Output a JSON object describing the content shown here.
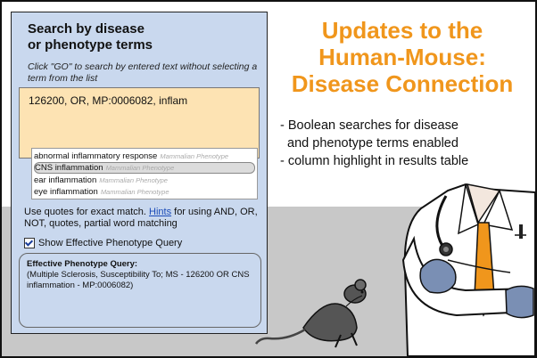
{
  "search_panel": {
    "title_line1": "Search by disease",
    "title_line2": "or phenotype terms",
    "instructions": "Click \"GO\" to search by entered text without selecting a term from the list",
    "query_value": "126200, OR, MP:0006082, inflam",
    "dropdown": [
      {
        "term": "abnormal inflammatory response",
        "category": "Mammalian Phenotype",
        "selected": false
      },
      {
        "term": "CNS inflammation",
        "category": "Mammalian Phenotype",
        "selected": true
      },
      {
        "term": "ear inflammation",
        "category": "Mammalian Phenotype",
        "selected": false
      },
      {
        "term": "eye inflammation",
        "category": "Mammalian Phenotype",
        "selected": false
      }
    ],
    "quotes_text_before": "Use quotes for exact match. ",
    "hints_link": "Hints",
    "quotes_text_after": " for using AND, OR, NOT, quotes, partial word matching",
    "show_effective_label": "Show Effective Phenotype Query",
    "effective_title": "Effective Phenotype Query:",
    "effective_body": "(Multiple Sclerosis, Susceptibility To; MS - 126200 OR CNS inflammation - MP:0006082)"
  },
  "headline": {
    "line1": "Updates to the",
    "line2": "Human-Mouse:",
    "line3": "Disease Connection"
  },
  "bullets": [
    "- Boolean searches for disease",
    "  and phenotype terms enabled",
    "- column highlight in results table"
  ],
  "colors": {
    "headline": "#f0961c",
    "panel": "#c9d8ee",
    "query_box": "#fde3b3",
    "tie": "#f0961c",
    "glove": "#7a8fb4"
  },
  "icons": [
    "stethoscope-icon",
    "mouse-icon",
    "checkbox-checked-icon"
  ]
}
